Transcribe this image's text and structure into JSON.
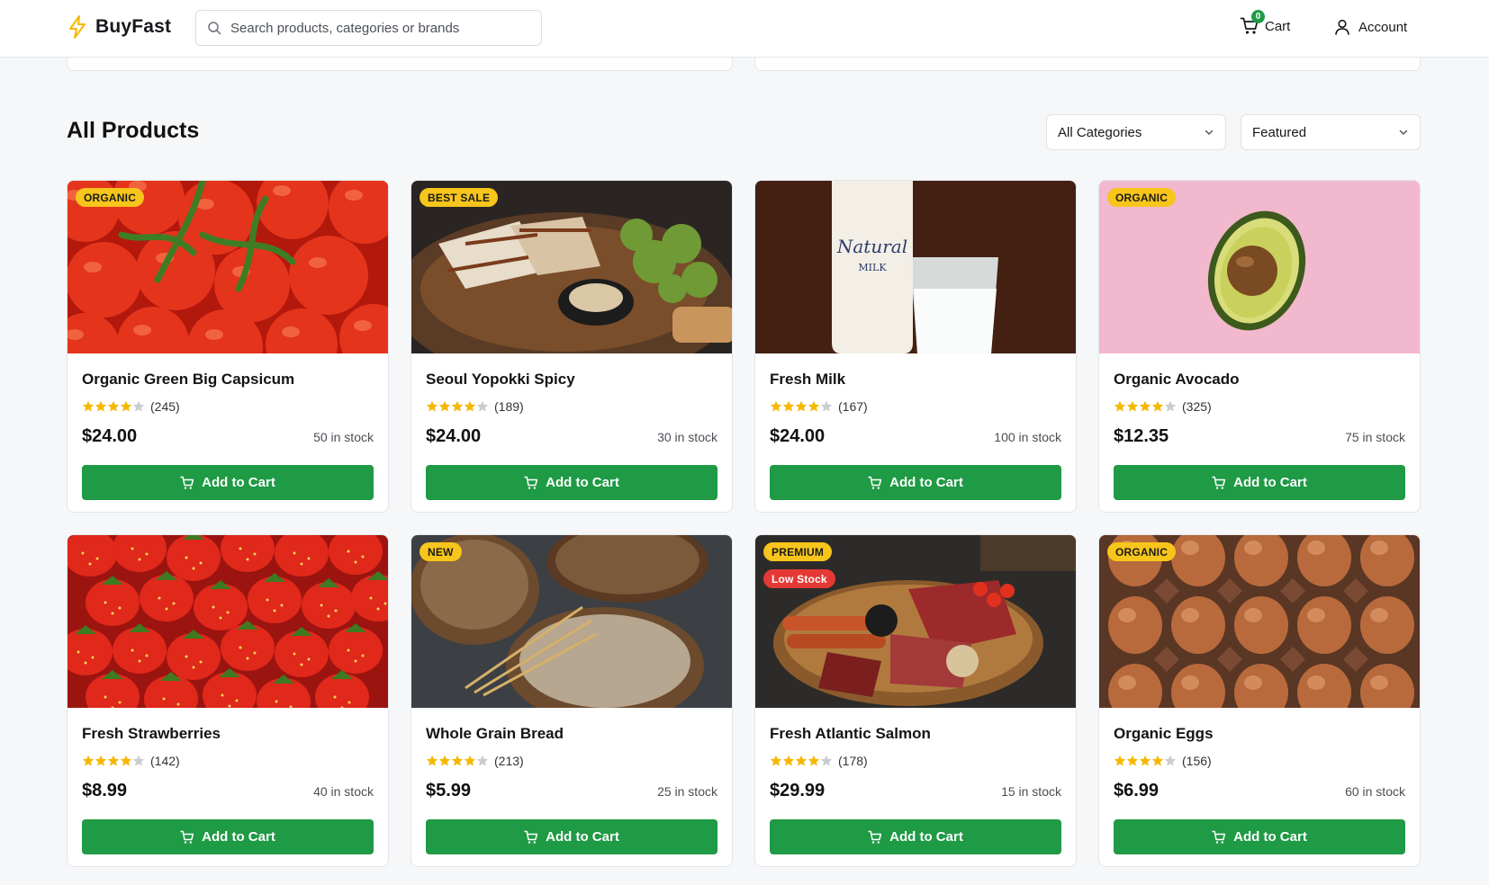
{
  "header": {
    "brand": "BuyFast",
    "search_placeholder": "Search products, categories or brands",
    "cart_label": "Cart",
    "cart_count": "0",
    "account_label": "Account"
  },
  "section": {
    "title": "All Products",
    "category_select": "All Categories",
    "sort_select": "Featured"
  },
  "colors": {
    "accent_green": "#1f9a45",
    "badge_yellow": "#f7c51b",
    "badge_red": "#e53935",
    "star_gold": "#f5b800"
  },
  "add_to_cart_label": "Add to Cart",
  "products": [
    {
      "name": "Organic Green Big Capsicum",
      "badge": "ORGANIC",
      "reviews": "(245)",
      "price": "$24.00",
      "stock": "50 in stock",
      "image": "tomatoes"
    },
    {
      "name": "Seoul Yopokki Spicy",
      "badge": "BEST SALE",
      "reviews": "(189)",
      "price": "$24.00",
      "stock": "30 in stock",
      "image": "grilled-dish"
    },
    {
      "name": "Fresh Milk",
      "badge": "",
      "reviews": "(167)",
      "price": "$24.00",
      "stock": "100 in stock",
      "image": "milk"
    },
    {
      "name": "Organic Avocado",
      "badge": "ORGANIC",
      "reviews": "(325)",
      "price": "$12.35",
      "stock": "75 in stock",
      "image": "avocado"
    },
    {
      "name": "Fresh Strawberries",
      "badge": "",
      "reviews": "(142)",
      "price": "$8.99",
      "stock": "40 in stock",
      "image": "strawberries"
    },
    {
      "name": "Whole Grain Bread",
      "badge": "NEW",
      "reviews": "(213)",
      "price": "$5.99",
      "stock": "25 in stock",
      "image": "bread"
    },
    {
      "name": "Fresh Atlantic Salmon",
      "badge": "PREMIUM",
      "badge2": "Low Stock",
      "reviews": "(178)",
      "price": "$29.99",
      "stock": "15 in stock",
      "image": "meat-board"
    },
    {
      "name": "Organic Eggs",
      "badge": "ORGANIC",
      "reviews": "(156)",
      "price": "$6.99",
      "stock": "60 in stock",
      "image": "eggs"
    }
  ]
}
